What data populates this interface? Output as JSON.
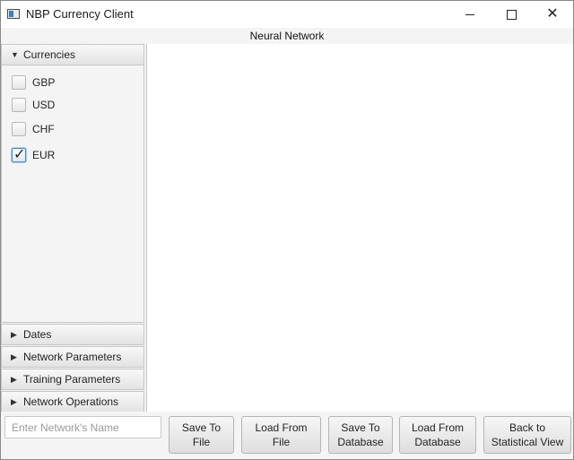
{
  "window": {
    "title": "NBP Currency Client",
    "controls": {
      "minimize": "minimize-icon",
      "maximize": "maximize-icon",
      "close": "close-icon",
      "close_glyph": "✕"
    }
  },
  "view": {
    "title": "Neural Network"
  },
  "sidebar": {
    "sections": [
      {
        "label": "Currencies",
        "expanded": true
      },
      {
        "label": "Dates",
        "expanded": false
      },
      {
        "label": "Network Parameters",
        "expanded": false
      },
      {
        "label": "Training Parameters",
        "expanded": false
      },
      {
        "label": "Network Operations",
        "expanded": false
      }
    ],
    "currencies": [
      {
        "label": "GBP",
        "checked": false
      },
      {
        "label": "USD",
        "checked": false
      },
      {
        "label": "CHF",
        "checked": false
      },
      {
        "label": "EUR",
        "checked": true
      }
    ],
    "glyphs": {
      "expanded": "▼",
      "collapsed": "▶",
      "check": "✓"
    }
  },
  "bottom": {
    "name_input": {
      "placeholder": "Enter Network's Name",
      "value": ""
    },
    "buttons": [
      {
        "label": "Save To\nFile"
      },
      {
        "label": "Load From File"
      },
      {
        "label": "Save To\nDatabase"
      },
      {
        "label": "Load From\nDatabase"
      },
      {
        "label": "Back to\nStatistical View"
      }
    ]
  },
  "colors": {
    "accent": "#3a8fd6",
    "panel": "#f4f4f4",
    "border": "#c6c6c6"
  }
}
